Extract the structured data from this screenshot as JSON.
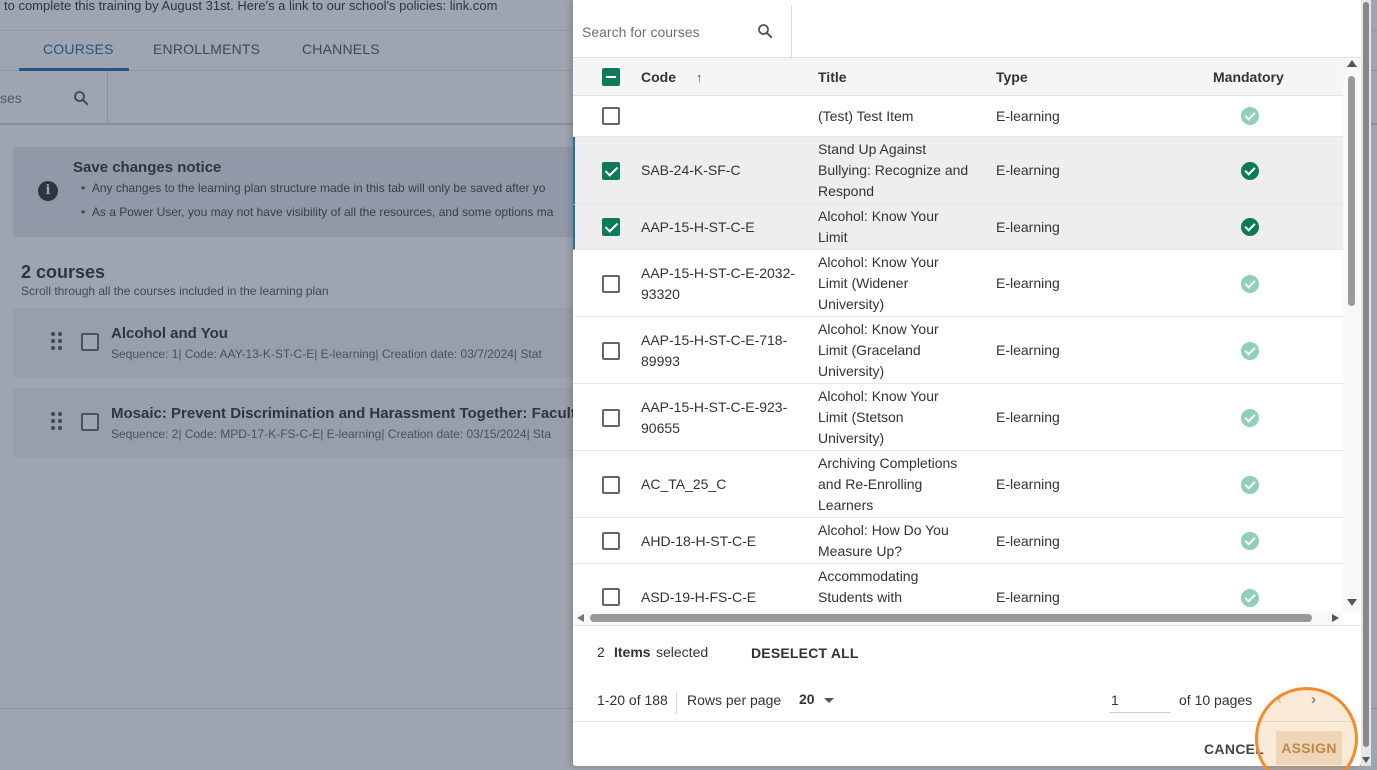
{
  "background": {
    "top_text": "to complete this training by August 31st.  Here's a link to our school's policies: link.com",
    "tabs": [
      {
        "label": "COURSES",
        "active": true
      },
      {
        "label": "ENROLLMENTS",
        "active": false
      },
      {
        "label": "CHANNELS",
        "active": false
      }
    ],
    "search_fragment": "ses",
    "notice": {
      "icon": "info-icon",
      "title": "Save changes notice",
      "line1": "Any changes to the learning plan structure made in this tab will only be saved after yo",
      "line2": "As a Power User, you may not have visibility of all the resources, and some options ma"
    },
    "courses_title": "2 courses",
    "courses_sub": "Scroll through all the courses included in the learning plan",
    "course_cards": [
      {
        "title": "Alcohol and You",
        "meta": "Sequence: 1| Code: AAY-13-K-ST-C-E| E-learning| Creation date: 03/7/2024| Stat"
      },
      {
        "title": "Mosaic: Prevent Discrimination and Harassment Together: Faculty &",
        "meta": "Sequence: 2| Code: MPD-17-K-FS-C-E| E-learning| Creation date: 03/15/2024| Sta"
      }
    ]
  },
  "modal": {
    "search": {
      "placeholder": "Search for courses",
      "value": ""
    },
    "columns": {
      "code": "Code",
      "title": "Title",
      "type": "Type",
      "mandatory": "Mandatory"
    },
    "header_checkbox": "partial",
    "rows": [
      {
        "code": "",
        "title": [
          "(Test) Test Item"
        ],
        "type": "E-learning",
        "selected": false
      },
      {
        "code": "SAB-24-K-SF-C",
        "title": [
          "Stand Up Against",
          "Bullying: Recognize and",
          "Respond"
        ],
        "type": "E-learning",
        "selected": true
      },
      {
        "code": "AAP-15-H-ST-C-E",
        "title": [
          "Alcohol: Know Your",
          "Limit"
        ],
        "type": "E-learning",
        "selected": true
      },
      {
        "code": "AAP-15-H-ST-C-E-2032-93320",
        "title": [
          "Alcohol: Know Your",
          "Limit (Widener",
          "University)"
        ],
        "type": "E-learning",
        "selected": false
      },
      {
        "code": "AAP-15-H-ST-C-E-718-89993",
        "title": [
          "Alcohol: Know Your",
          "Limit (Graceland",
          "University)"
        ],
        "type": "E-learning",
        "selected": false
      },
      {
        "code": "AAP-15-H-ST-C-E-923-90655",
        "title": [
          "Alcohol: Know Your",
          "Limit (Stetson",
          "University)"
        ],
        "type": "E-learning",
        "selected": false
      },
      {
        "code": "AC_TA_25_C",
        "title": [
          "Archiving Completions",
          "and Re-Enrolling",
          "Learners"
        ],
        "type": "E-learning",
        "selected": false
      },
      {
        "code": "AHD-18-H-ST-C-E",
        "title": [
          "Alcohol: How Do You",
          "Measure Up?"
        ],
        "type": "E-learning",
        "selected": false
      },
      {
        "code": "ASD-19-H-FS-C-E",
        "title": [
          "Accommodating",
          "Students with"
        ],
        "type": "E-learning",
        "selected": false
      }
    ],
    "selection": {
      "count": "2",
      "items_label": "Items",
      "selected_label": "selected",
      "deselect_all": "DESELECT ALL"
    },
    "pager": {
      "range": "1-20 of 188",
      "rows_per_page_label": "Rows per page",
      "rows_per_page": "20",
      "page": "1",
      "of_pages": "of 10 pages"
    },
    "actions": {
      "cancel": "CANCEL",
      "assign": "ASSIGN"
    },
    "colors": {
      "accent_green": "#0f7a5a",
      "mandatory_light": "#8fd0b6",
      "tab_blue": "#1e6fb0",
      "highlight_orange": "#f08c2a"
    }
  }
}
